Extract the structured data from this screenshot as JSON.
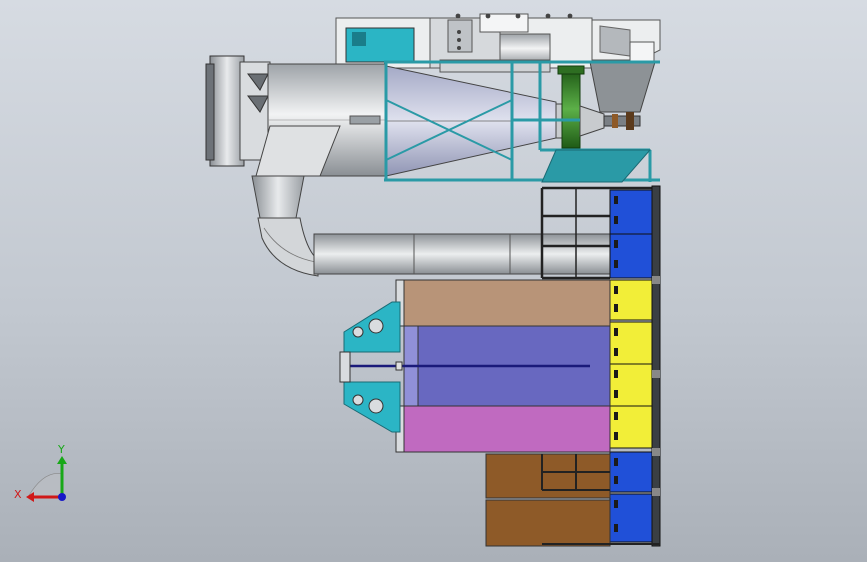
{
  "viewport": {
    "background_top": "#d6dbe2",
    "background_bottom": "#aab0b8"
  },
  "triad": {
    "x_label": "X",
    "y_label": "Y",
    "x_color": "#d01818",
    "y_color": "#18a818",
    "z_color": "#1818c8"
  },
  "palette": {
    "frame": "#2a9aa6",
    "frame_light": "#4fc4cf",
    "duct": "#c8cbce",
    "motor": "#3a8a2a",
    "panel_blue": "#2050d8",
    "panel_yellow": "#f2ee38",
    "bin_tan": "#b89478",
    "bin_purple": "#6868c0",
    "bin_magenta": "#c06ac0",
    "bin_brown": "#8e5a28"
  }
}
